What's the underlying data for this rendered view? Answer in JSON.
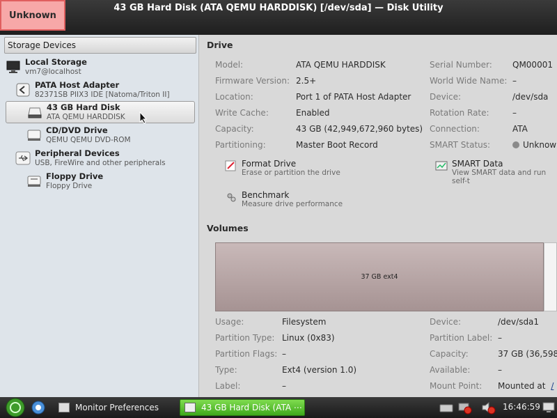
{
  "window": {
    "title": "43 GB Hard Disk (ATA QEMU HARDDISK) [/dev/sda] — Disk Utility",
    "badge": "Unknown"
  },
  "sidebar": {
    "header": "Storage Devices",
    "items": [
      {
        "name": "Local Storage",
        "sub": "vm7@localhost",
        "icon": "computer-icon"
      },
      {
        "name": "PATA Host Adapter",
        "sub": "82371SB PIIX3 IDE [Natoma/Triton II]",
        "icon": "host-adapter-icon"
      },
      {
        "name": "43 GB Hard Disk",
        "sub": "ATA QEMU HARDDISK",
        "icon": "hard-disk-icon"
      },
      {
        "name": "CD/DVD Drive",
        "sub": "QEMU QEMU DVD-ROM",
        "icon": "optical-drive-icon"
      },
      {
        "name": "Peripheral Devices",
        "sub": "USB, FireWire and other peripherals",
        "icon": "usb-icon"
      },
      {
        "name": "Floppy Drive",
        "sub": "Floppy Drive",
        "icon": "floppy-drive-icon"
      }
    ]
  },
  "drive": {
    "section_title": "Drive",
    "left": [
      {
        "label": "Model:",
        "value": "ATA QEMU HARDDISK"
      },
      {
        "label": "Firmware Version:",
        "value": "2.5+"
      },
      {
        "label": "Location:",
        "value": "Port 1 of PATA Host Adapter"
      },
      {
        "label": "Write Cache:",
        "value": "Enabled"
      },
      {
        "label": "Capacity:",
        "value": "43 GB (42,949,672,960 bytes)"
      },
      {
        "label": "Partitioning:",
        "value": "Master Boot Record"
      }
    ],
    "right": [
      {
        "label": "Serial Number:",
        "value": "QM00001"
      },
      {
        "label": "World Wide Name:",
        "value": "–"
      },
      {
        "label": "Device:",
        "value": "/dev/sda"
      },
      {
        "label": "Rotation Rate:",
        "value": "–"
      },
      {
        "label": "Connection:",
        "value": "ATA"
      },
      {
        "label": "SMART Status:",
        "value": "Unknow"
      }
    ],
    "actions": [
      {
        "title": "Format Drive",
        "sub": "Erase or partition the drive"
      },
      {
        "title": "SMART Data",
        "sub": "View SMART data and run self-t"
      },
      {
        "title": "Benchmark",
        "sub": "Measure drive performance"
      }
    ]
  },
  "volumes": {
    "section_title": "Volumes",
    "bar_label": "37 GB ext4",
    "left": [
      {
        "label": "Usage:",
        "value": "Filesystem"
      },
      {
        "label": "Partition Type:",
        "value": "Linux (0x83)"
      },
      {
        "label": "Partition Flags:",
        "value": "–"
      },
      {
        "label": "Type:",
        "value": "Ext4 (version 1.0)"
      },
      {
        "label": "Label:",
        "value": "–"
      }
    ],
    "right": [
      {
        "label": "Device:",
        "value": "/dev/sda1"
      },
      {
        "label": "Partition Label:",
        "value": "–"
      },
      {
        "label": "Capacity:",
        "value": "37 GB (36,598,’"
      },
      {
        "label": "Available:",
        "value": "–"
      },
      {
        "label": "Mount Point:",
        "value": "Mounted at",
        "link": "/"
      }
    ]
  },
  "taskbar": {
    "monitor_label": "Monitor Preferences",
    "disk_label": "43 GB Hard Disk (ATA ⋯",
    "clock": "16:46:59"
  }
}
